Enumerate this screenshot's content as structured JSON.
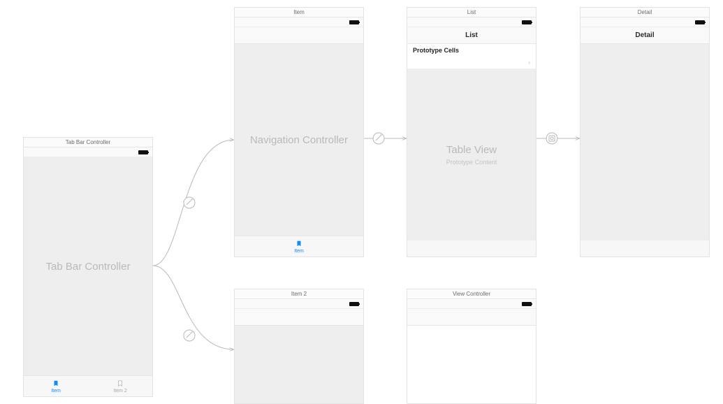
{
  "scenes": {
    "tabbar": {
      "title": "Tab Bar Controller",
      "placeholder": "Tab Bar Controller",
      "tabs": [
        {
          "label": "Item",
          "active": true
        },
        {
          "label": "Item 2",
          "active": false
        }
      ]
    },
    "navItem": {
      "title": "Item",
      "placeholder": "Navigation Controller",
      "tab_label": "Item"
    },
    "list": {
      "title": "List",
      "nav_title": "List",
      "section_header": "Prototype Cells",
      "body_title": "Table View",
      "body_sub": "Prototype Content"
    },
    "detail": {
      "title": "Detail",
      "nav_title": "Detail"
    },
    "navItem2": {
      "title": "Item 2"
    },
    "viewController": {
      "title": "View Controller"
    }
  }
}
